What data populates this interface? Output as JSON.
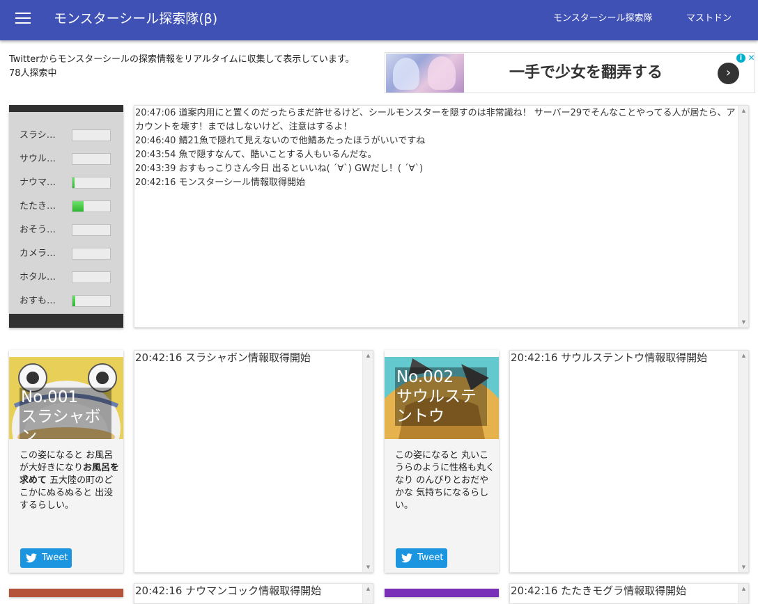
{
  "appbar": {
    "title": "モンスターシール探索隊(β)",
    "nav": [
      "モンスターシール探索隊",
      "マストドン"
    ]
  },
  "intro": {
    "line1": "Twitterからモンスターシールの探索情報をリアルタイムに収集して表示しています。",
    "line2": "78人探索中"
  },
  "ad": {
    "text": "一手で少女を翻弄する",
    "arrow": "›",
    "info": "i",
    "close": "✕"
  },
  "gauges": [
    {
      "label": "スラシャボン",
      "level": 0
    },
    {
      "label": "サウルステントウ",
      "level": 0
    },
    {
      "label": "ナウマンコック",
      "level": 0.05
    },
    {
      "label": "たたきモグラ",
      "level": 0.3
    },
    {
      "label": "おそうじアザラシ",
      "level": 0
    },
    {
      "label": "カメラマンタ",
      "level": 0
    },
    {
      "label": "ホタルイカ",
      "level": 0
    },
    {
      "label": "おすもっこり",
      "level": 0.07
    }
  ],
  "main_log": [
    "20:47:06 道案内用にと置くのだったらまだ許せるけど、シールモンスターを隠すのは非常識ね！ サーバー29でそんなことやってる人が居たら、アカウントを壊す！まではしないけど、注意はするよ！",
    "20:46:40 鯖21魚で隠れて見えないので他鯖あたったほうがいいですね",
    "20:43:54 魚で隠すなんて、酷いことする人もいるんだな。",
    "20:43:39 おすもっこりさん今日 出るといいね( ´∀`) GWだし！( ´∀`)",
    "20:42:16 モンスターシール情報取得開始"
  ],
  "cards": [
    {
      "number": "No.001",
      "name": "スラシャボン",
      "desc_pre": "この姿になると お風呂が大好きになり",
      "desc_bold": "お風呂を求めて",
      "desc_post": " 五大陸の町のどこかにぬるぬると 出没するらしい。",
      "tweet": "Tweet",
      "feed": [
        "20:42:16 スラシャボン情報取得開始"
      ]
    },
    {
      "number": "No.002",
      "name": "サウルステントウ",
      "desc_pre": "この姿になると 丸いこうらのように性格も丸くなり のんびりとおだやかな 気持ちになるらしい。",
      "desc_bold": "",
      "desc_post": "",
      "tweet": "Tweet",
      "feed": [
        "20:42:16 サウルステントウ情報取得開始"
      ]
    }
  ],
  "next_feeds": [
    "20:42:16 ナウマンコック情報取得開始",
    "20:42:16 たたきモグラ情報取得開始"
  ],
  "colors": {
    "appbar": "#3f51b5",
    "tweet": "#1b95e0",
    "gauge_fill": "#3cc43c"
  }
}
